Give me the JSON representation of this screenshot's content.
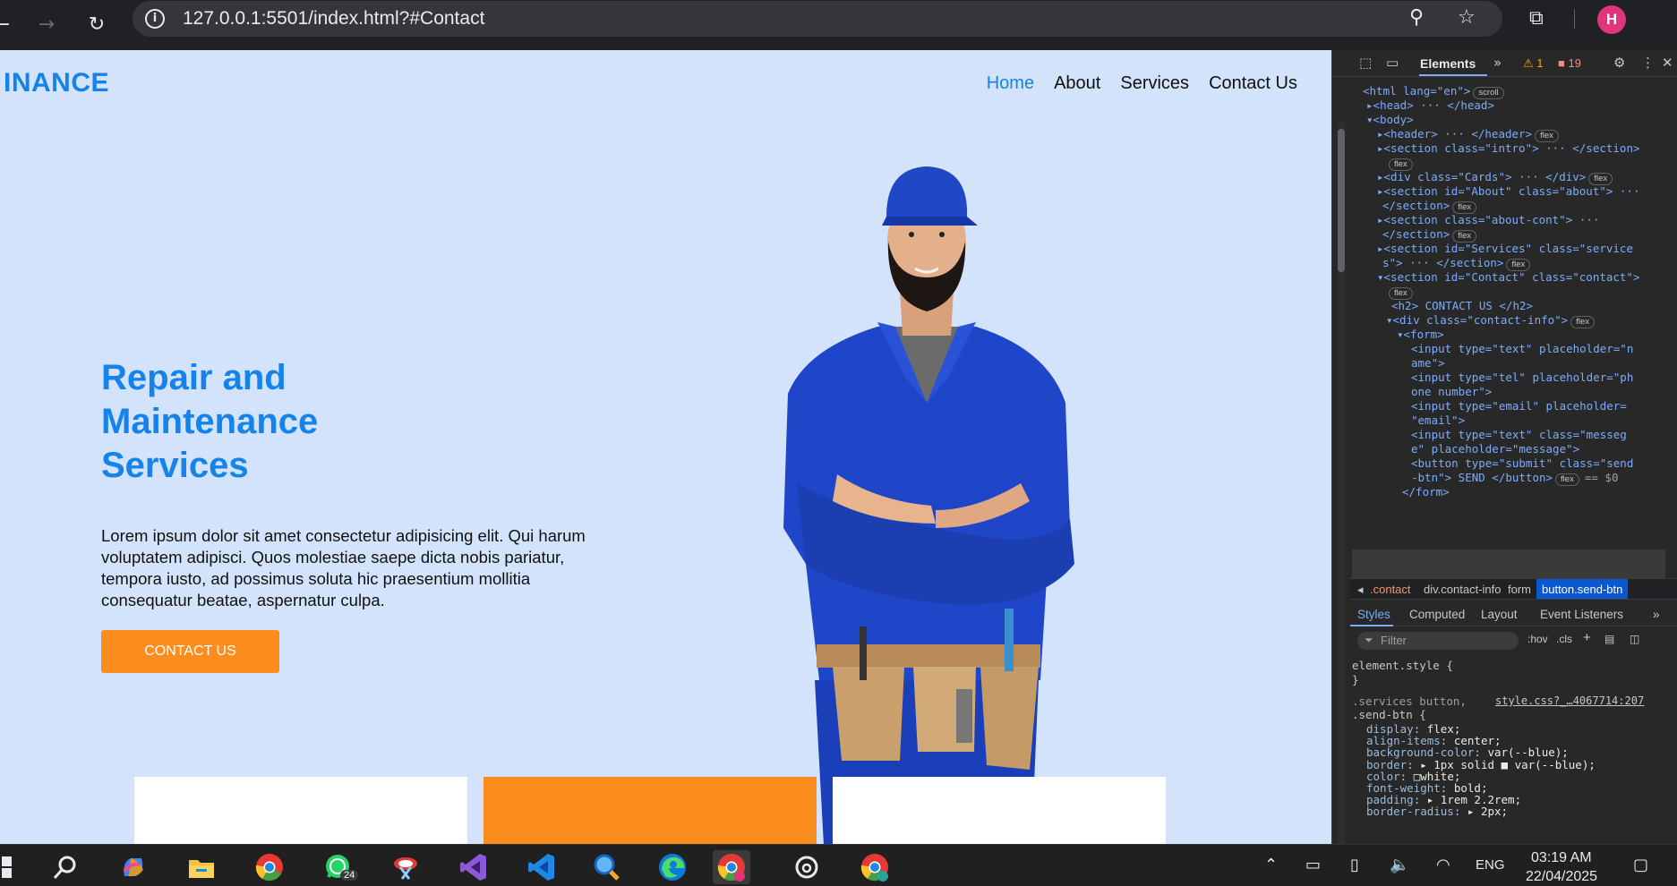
{
  "browser": {
    "url": "127.0.0.1:5501/index.html?#Contact",
    "icons": [
      "back-icon",
      "forward-icon",
      "reload-icon",
      "site-info-icon",
      "zoom-icon",
      "bookmark-star-icon",
      "extensions-icon"
    ],
    "profile_initial": "H"
  },
  "site": {
    "logo": "INANCE",
    "nav": [
      "Home",
      "About",
      "Services",
      "Contact Us"
    ],
    "hero_title_lines": [
      "Repair and",
      "Maintenance",
      "Services"
    ],
    "hero_text": "Lorem ipsum dolor sit amet consectetur adipisicing elit. Qui harum voluptatem adipisci. Quos molestiae saepe dicta nobis pariatur, tempora iusto, ad possimus soluta hic praesentium mollitia consequatur beatae, aspernatur culpa.",
    "cta": "CONTACT US",
    "colors": {
      "accent": "#1583e9",
      "orange": "#fb8c1e",
      "bg": "#d2e3fb"
    }
  },
  "devtools": {
    "active_tab": "Elements",
    "warnings": "1",
    "errors": "19",
    "dom_lines": [
      {
        "t": "<html lang=\"en\">",
        "b": "scroll"
      },
      {
        "t": "▸<head> ··· </head>"
      },
      {
        "t": "▾<body>"
      },
      {
        "t": "▸<header> ··· </header>",
        "b": "flex"
      },
      {
        "t": "▸<section class=\"intro\"> ··· </section>"
      },
      {
        "t": "",
        "b": "flex"
      },
      {
        "t": "▸<div class=\"Cards\"> ··· </div>",
        "b": "flex"
      },
      {
        "t": "▸<section id=\"About\" class=\"about\"> ···"
      },
      {
        "t": "</section>",
        "b": "flex"
      },
      {
        "t": "▸<section class=\"about-cont\"> ···"
      },
      {
        "t": "</section>",
        "b": "flex"
      },
      {
        "t": "▸<section id=\"Services\" class=\"service"
      },
      {
        "t": "s\"> ··· </section>",
        "b": "flex"
      },
      {
        "t": "▾<section id=\"Contact\" class=\"contact\">"
      },
      {
        "t": "",
        "b": "flex"
      },
      {
        "t": "<h2> CONTACT US </h2>"
      },
      {
        "t": "▾<div class=\"contact-info\">",
        "b": "flex"
      },
      {
        "t": "▾<form>"
      },
      {
        "t": "<input type=\"text\" placeholder=\"n"
      },
      {
        "t": "ame\">"
      },
      {
        "t": "<input type=\"tel\" placeholder=\"ph"
      },
      {
        "t": "one number\">"
      },
      {
        "t": "<input type=\"email\" placeholder="
      },
      {
        "t": "\"email\">"
      },
      {
        "t": "<input type=\"text\" class=\"messeg"
      },
      {
        "t": "e\" placeholder=\"message\">"
      },
      {
        "t": "<button type=\"submit\" class=\"send"
      },
      {
        "t": "-btn\"> SEND </button>",
        "b": "flex",
        "extra": "== $0"
      },
      {
        "t": "</form>"
      }
    ],
    "breadcrumbs": [
      ".contact",
      "div.contact-info",
      "form",
      "button.send-btn"
    ],
    "subtabs": [
      "Styles",
      "Computed",
      "Layout",
      "Event Listeners"
    ],
    "filter_placeholder": "Filter",
    "tools": [
      ":hov",
      ".cls"
    ],
    "styles": {
      "element_style": "element.style {",
      "close": "}",
      "selector1": ".services button,",
      "selector2": ".send-btn {",
      "source": "style.css?_…4067714:207",
      "props": [
        {
          "p": "display",
          "v": "flex;"
        },
        {
          "p": "align-items",
          "v": "center;"
        },
        {
          "p": "background-color",
          "v": "var(--blue);"
        },
        {
          "p": "border",
          "v": "▸ 1px solid ■ var(--blue);"
        },
        {
          "p": "color",
          "v": "□white;"
        },
        {
          "p": "font-weight",
          "v": "bold;"
        },
        {
          "p": "padding",
          "v": "▸ 1rem 2.2rem;"
        },
        {
          "p": "border-radius",
          "v": "▸ 2px;"
        }
      ]
    }
  },
  "taskbar": {
    "apps": [
      "windows-start-icon",
      "search-icon",
      "copilot-icon",
      "file-explorer-icon",
      "chrome-icon",
      "whatsapp-icon",
      "snipping-tool-icon",
      "visual-studio-icon",
      "vscode-icon",
      "magnifier-icon",
      "edge-icon",
      "chrome-profile-icon",
      "threads-icon",
      "chrome-profile-2-icon"
    ],
    "whatsapp_badge": "24",
    "language": "ENG",
    "time": "03:19 AM",
    "date": "22/04/2025"
  }
}
